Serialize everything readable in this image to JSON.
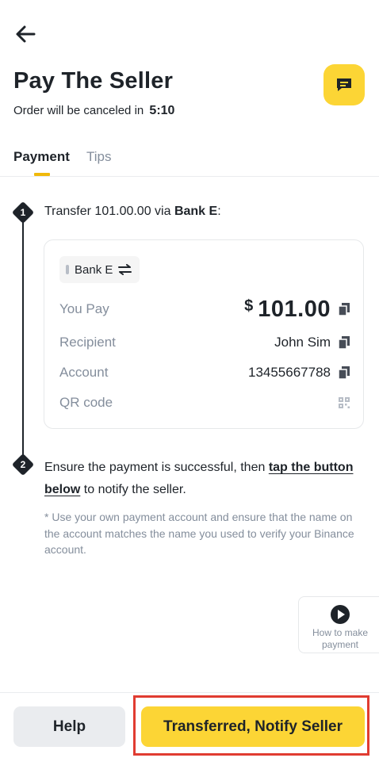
{
  "header": {
    "back_icon": "arrow-left-icon",
    "title": "Pay The Seller",
    "cancel_text": "Order will be canceled in",
    "countdown": "5:10",
    "chat_icon": "chat-icon",
    "accent_color": "#fcd535"
  },
  "tabs": [
    {
      "label": "Payment",
      "active": true
    },
    {
      "label": "Tips",
      "active": false
    }
  ],
  "step1": {
    "number": "1",
    "text_prefix": "Transfer 101.00.00 via",
    "bank": "Bank E",
    "text_suffix": ":"
  },
  "payment_card": {
    "bank_chip": "Bank E",
    "switch_icon": "swap-arrows-icon",
    "you_pay_label": "You Pay",
    "currency_symbol": "$",
    "amount": "101.00",
    "recipient_label": "Recipient",
    "recipient_value": "John Sim",
    "account_label": "Account",
    "account_value": "13455667788",
    "qr_label": "QR code",
    "copy_icon": "copy-icon",
    "qr_icon": "qr-code-icon"
  },
  "step2": {
    "number": "2",
    "text_prefix": "Ensure the payment is successful, then",
    "text_link": "tap the button below",
    "text_suffix": "to notify the seller."
  },
  "note": "* Use your own payment account and ensure that the name on the account matches the name you used to verify your Binance account.",
  "how_to": {
    "icon": "play-icon",
    "label": "How to make payment"
  },
  "footer": {
    "help_label": "Help",
    "confirm_label": "Transferred, Notify Seller",
    "highlight_color": "#e03c31"
  }
}
